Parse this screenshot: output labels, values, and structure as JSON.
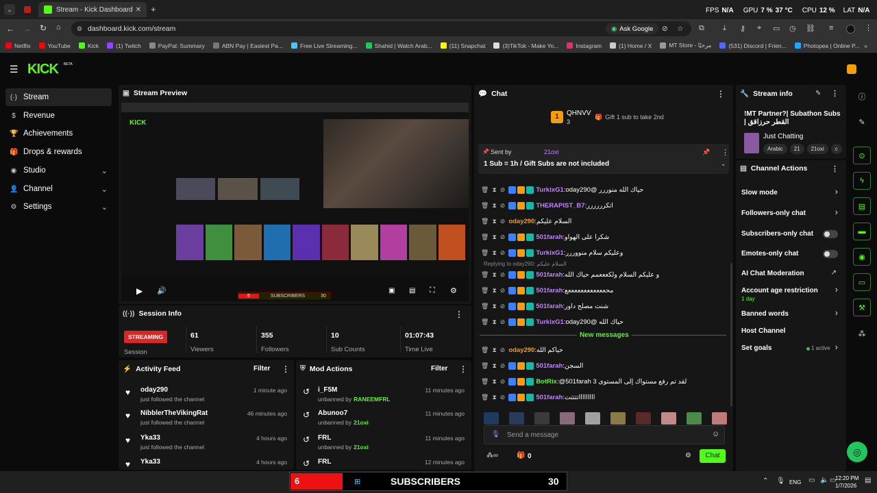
{
  "browser": {
    "tab_title": "Stream - Kick Dashboard",
    "url": "dashboard.kick.com/stream",
    "ask_google": "Ask Google",
    "perf": {
      "fps_label": "FPS",
      "fps": "N/A",
      "gpu_label": "GPU",
      "gpu": "7 %",
      "gpu_temp": "37 °C",
      "cpu_label": "CPU",
      "cpu": "12 %",
      "lat_label": "LAT",
      "lat": "N/A"
    },
    "bookmarks": [
      {
        "label": "Netflix",
        "color": "#e50914"
      },
      {
        "label": "YouTube",
        "color": "#ff0000"
      },
      {
        "label": "Kick",
        "color": "#53fc18"
      },
      {
        "label": "(1) Twitch",
        "color": "#9146ff"
      },
      {
        "label": "PayPal: Summary",
        "color": "#888888"
      },
      {
        "label": "ABN Pay | Easiest Pa...",
        "color": "#777777"
      },
      {
        "label": "Free Live Streaming...",
        "color": "#4fc3f7"
      },
      {
        "label": "Shahid | Watch Arab...",
        "color": "#22c55e"
      },
      {
        "label": "(11) Snapchat",
        "color": "#fffc00"
      },
      {
        "label": "(3)TikTok - Make Yo...",
        "color": "#dddddd"
      },
      {
        "label": "Instagram",
        "color": "#e1306c"
      },
      {
        "label": "(1) Home / X",
        "color": "#cccccc"
      },
      {
        "label": "MT Store - مرحبًا",
        "color": "#999999"
      },
      {
        "label": "(531) Discord | Frien...",
        "color": "#5865f2"
      },
      {
        "label": "Photopea | Online P...",
        "color": "#1ea7fd"
      }
    ]
  },
  "app": {
    "logo": "KICK",
    "logo_tag": "BETA"
  },
  "sidebar": {
    "items": [
      {
        "label": "Stream",
        "icon": "(·)"
      },
      {
        "label": "Revenue",
        "icon": "$"
      },
      {
        "label": "Achievements",
        "icon": "🏆"
      },
      {
        "label": "Drops & rewards",
        "icon": "🎁"
      },
      {
        "label": "Studio",
        "icon": "◉"
      },
      {
        "label": "Channel",
        "icon": "👤"
      },
      {
        "label": "Settings",
        "icon": "⚙"
      }
    ]
  },
  "preview": {
    "title": "Stream Preview",
    "banner": "SUBSCRIBERS",
    "banner_left": "6",
    "banner_right": "30"
  },
  "session": {
    "title": "Session Info",
    "status": "STREAMING",
    "session_label": "Session",
    "stats": [
      {
        "value": "61",
        "label": "Viewers"
      },
      {
        "value": "355",
        "label": "Followers"
      },
      {
        "value": "10",
        "label": "Sub Counts"
      },
      {
        "value": "01:07:43",
        "label": "Time Live"
      }
    ]
  },
  "activity": {
    "title": "Activity Feed",
    "filter": "Filter",
    "items": [
      {
        "name": "oday290",
        "sub": "just followed the channel",
        "ago": "1 minute ago"
      },
      {
        "name": "NibblerTheVikingRat",
        "sub": "just followed the channel",
        "ago": "46 minutes ago"
      },
      {
        "name": "Yka33",
        "sub": "just followed the channel",
        "ago": "4 hours ago"
      },
      {
        "name": "Yka33",
        "sub": "",
        "ago": "4 hours ago"
      }
    ]
  },
  "mod": {
    "title": "Mod Actions",
    "filter": "Filter",
    "items": [
      {
        "name": "i_F5M",
        "sub": "unbanned by",
        "by": "RANEEMFRL",
        "ago": "11 minutes ago"
      },
      {
        "name": "Abunoo7",
        "sub": "unbanned by",
        "by": "21oxi",
        "ago": "11 minutes ago"
      },
      {
        "name": "FRL",
        "sub": "unbanned by",
        "by": "21oxi",
        "ago": "11 minutes ago"
      },
      {
        "name": "FRL",
        "sub": "",
        "by": "",
        "ago": "12 minutes ago"
      }
    ]
  },
  "chat": {
    "title": "Chat",
    "top_gifter": "QHNVV",
    "top_count": "3",
    "gift_hint": "Gift 1 sub to take 2nd",
    "pinned_label": "Sent by",
    "pinned_user": "21oxi",
    "pinned_text": "1 Sub = 1h / Gift Subs are not included",
    "messages": [
      {
        "user": "TurkixG1",
        "color": "#c084fc",
        "text": "حياك الله منوررر @oday290"
      },
      {
        "user": "THERAPIST_B7",
        "color": "#c084fc",
        "text": "اتكرررررر"
      },
      {
        "user": "oday290",
        "color": "#f59e0b",
        "text": "السلام عليكم"
      },
      {
        "user": "501farah",
        "color": "#c084fc",
        "text": "شكرا على الهواو"
      },
      {
        "user": "TurkixG1",
        "color": "#c084fc",
        "text": "وعليكم سلام منووررر"
      },
      {
        "user": "501farah",
        "color": "#c084fc",
        "text": "و عليكم السلام ولكعععمم حياك الله"
      },
      {
        "user": "501farah",
        "color": "#c084fc",
        "text": "محععععععععععععع"
      },
      {
        "user": "501farah",
        "color": "#c084fc",
        "text": "شنت مصلح داور"
      },
      {
        "user": "TurkixG1",
        "color": "#c084fc",
        "text": "حياك الله @oday290"
      },
      {
        "user": "oday290",
        "color": "#f59e0b",
        "text": "حياكم الله"
      },
      {
        "user": "501farah",
        "color": "#c084fc",
        "text": "السجن"
      },
      {
        "user": "BotRix",
        "color": "#53fc18",
        "text": "@501farah 3 لقد تم رفع مستواك إلى المستوى"
      },
      {
        "user": "501farah",
        "color": "#c084fc",
        "text": "اااااااااتتتتت"
      }
    ],
    "reply_to": "Replying to oday290: السلام عليكم",
    "new_messages": "New messages",
    "input_placeholder": "Send a message",
    "count": "0",
    "send": "Chat"
  },
  "stream_info": {
    "title": "Stream info",
    "stream_title": "!MT Partner?| Subathon Subs | القطر حرزاقق",
    "category": "Just Chatting",
    "tags": [
      "Arabic",
      "21",
      "21oxi",
      "c"
    ]
  },
  "channel_actions": {
    "title": "Channel Actions",
    "items": [
      {
        "label": "Slow mode",
        "kind": "arrow"
      },
      {
        "label": "Followers-only chat",
        "kind": "arrow"
      },
      {
        "label": "Subscribers-only chat",
        "kind": "toggle"
      },
      {
        "label": "Emotes-only chat",
        "kind": "toggle"
      },
      {
        "label": "AI Chat Moderation",
        "kind": "link"
      },
      {
        "label": "Account age restriction",
        "sub": "1 day",
        "kind": "arrow"
      },
      {
        "label": "Banned words",
        "kind": "arrow"
      },
      {
        "label": "Host Channel",
        "kind": "none"
      },
      {
        "label": "Set goals",
        "sub_right": "1 active",
        "kind": "arrow"
      }
    ]
  },
  "taskbar": {
    "lang": "ENG",
    "time": "12:20 PM",
    "date": "1/7/2026"
  }
}
